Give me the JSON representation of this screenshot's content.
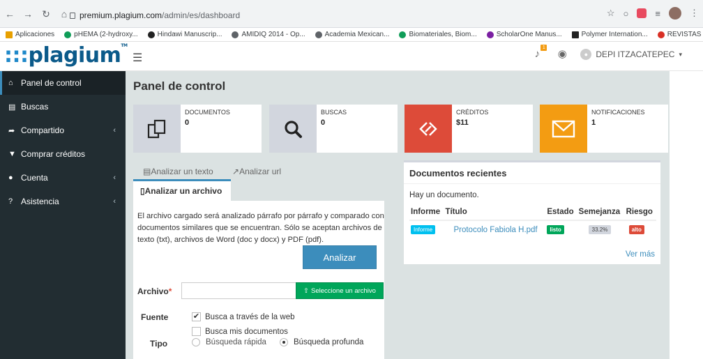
{
  "browser": {
    "url_host": "premium.plagium.com",
    "url_path": "/admin/es/dashboard",
    "bookmarks": [
      {
        "label": "Aplicaciones",
        "color": "#e8a000"
      },
      {
        "label": "pHEMA (2-hydroxy...",
        "color": "#0f9d58"
      },
      {
        "label": "Hindawi Manuscrip...",
        "color": "#222222"
      },
      {
        "label": "AMIDIQ 2014 - Op...",
        "color": "#5f6368"
      },
      {
        "label": "Academia Mexican...",
        "color": "#5f6368"
      },
      {
        "label": "Biomateriales, Biom...",
        "color": "#0f9d58"
      },
      {
        "label": "ScholarOne Manus...",
        "color": "#7b1fa2"
      },
      {
        "label": "Polymer Internation...",
        "color": "#222222"
      },
      {
        "label": "REVISTAS",
        "color": "#d93025"
      }
    ],
    "more": "»"
  },
  "header": {
    "logo_dots": ":::",
    "logo_text": "plagium",
    "logo_tm": "TM",
    "notif_badge": "1",
    "user_name": "DEPI ITZACATEPEC"
  },
  "sidebar": {
    "items": [
      {
        "label": "Panel de control",
        "icon": "home-icon",
        "glyph": "⌂",
        "caret": ""
      },
      {
        "label": "Buscas",
        "icon": "file-icon",
        "glyph": "▤",
        "caret": ""
      },
      {
        "label": "Compartido",
        "icon": "share-icon",
        "glyph": "➦",
        "caret": "‹"
      },
      {
        "label": "Comprar créditos",
        "icon": "cart-icon",
        "glyph": "▾",
        "caret": ""
      },
      {
        "label": "Cuenta",
        "icon": "user-icon",
        "glyph": "●",
        "caret": "‹"
      },
      {
        "label": "Asistencia",
        "icon": "help-icon",
        "glyph": "?",
        "caret": "‹"
      }
    ]
  },
  "main": {
    "title": "Panel de control",
    "stats": [
      {
        "label": "DOCUMENTOS",
        "value": "0",
        "color": "#d2d6de",
        "icon": "documents-icon"
      },
      {
        "label": "BUSCAS",
        "value": "0",
        "color": "#d2d6de",
        "icon": "search-icon"
      },
      {
        "label": "CRÉDITOS",
        "value": "$11",
        "color": "#dd4b39",
        "icon": "credits-icon"
      },
      {
        "label": "NOTIFICACIONES",
        "value": "1",
        "color": "#f39c12",
        "icon": "envelope-icon"
      }
    ],
    "tabs": {
      "texto": "Analizar un texto",
      "url": "Analizar url",
      "archivo": "Analizar un archivo"
    },
    "form": {
      "description": "El archivo cargado será analizado párrafo por párrafo y comparado con documentos similares que se encuentran. Sólo se aceptan archivos de texto (txt), archivos de Word (doc y docx) y PDF (pdf).",
      "archivo_label": "Archivo",
      "required_mark": "*",
      "select_button": "Seleccione un archivo",
      "fuente_label": "Fuente",
      "check_web": "Busca a través de la web",
      "check_docs": "Busca mis documentos",
      "tipo_label": "Tipo",
      "radio_rapida": "Búsqueda rápida",
      "radio_profunda": "Búsqueda profunda",
      "submit": "Analizar"
    },
    "recent": {
      "title": "Documentos recientes",
      "subtitle": "Hay un documento.",
      "columns": [
        "Informe",
        "Título",
        "Estado",
        "Semejanza",
        "Riesgo"
      ],
      "rows": [
        {
          "informe": "Informe",
          "titulo": "Protocolo Fabiola H.pdf",
          "estado": "listo",
          "semejanza": "33.2%",
          "riesgo": "alto"
        }
      ],
      "ver_mas": "Ver más"
    }
  }
}
